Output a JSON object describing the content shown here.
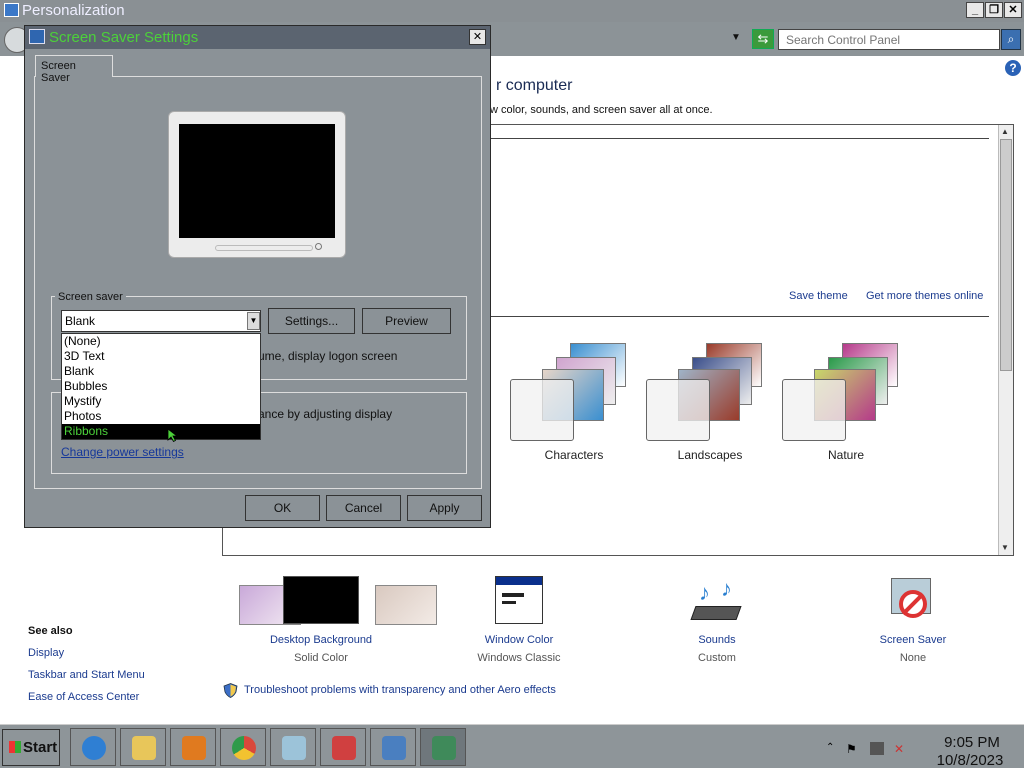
{
  "window": {
    "title": "Personalization",
    "minimize": "_",
    "restore": "❐",
    "close": "✕"
  },
  "address_bar": {
    "search_placeholder": "Search Control Panel",
    "dropdown_arrow": "▼",
    "refresh_glyph": "⇆",
    "search_glyph": "⌕"
  },
  "content": {
    "help_glyph": "?",
    "heading": "r computer",
    "subheading": "w color, sounds, and screen saver all at once.",
    "save_theme": "Save theme",
    "more_themes": "Get more themes online",
    "themes": [
      {
        "label": "Characters",
        "colors": [
          "#3a8fd0",
          "#d0a4cf",
          "#e7d5c8"
        ]
      },
      {
        "label": "Landscapes",
        "colors": [
          "#9a3b2a",
          "#3a4e8a",
          "#9fb3c7"
        ]
      },
      {
        "label": "Nature",
        "colors": [
          "#b53a8a",
          "#2a9a4a",
          "#c8d86a"
        ]
      }
    ],
    "settings": [
      {
        "title": "Desktop Background",
        "value": "Solid Color",
        "icon": "desktop-background-icon"
      },
      {
        "title": "Window Color",
        "value": "Windows Classic",
        "icon": "window-color-icon"
      },
      {
        "title": "Sounds",
        "value": "Custom",
        "icon": "sounds-icon"
      },
      {
        "title": "Screen Saver",
        "value": "None",
        "icon": "screen-saver-icon"
      }
    ],
    "see_also": {
      "title": "See also",
      "links": [
        "Display",
        "Taskbar and Start Menu",
        "Ease of Access Center"
      ]
    },
    "troubleshoot": "Troubleshoot problems with transparency and other Aero effects"
  },
  "dialog": {
    "title": "Screen Saver Settings",
    "close": "✕",
    "tab": "Screen Saver",
    "group_label": "Screen saver",
    "selected": "Blank",
    "select_arrow": "▼",
    "settings_btn": "Settings...",
    "preview_btn": "Preview",
    "logon_text": "ume, display logon screen",
    "power_text": "ance by adjusting display",
    "power_link": "Change power settings",
    "options": [
      "(None)",
      "3D Text",
      "Blank",
      "Bubbles",
      "Mystify",
      "Photos",
      "Ribbons"
    ],
    "highlighted_option": "Ribbons",
    "ok": "OK",
    "cancel": "Cancel",
    "apply": "Apply"
  },
  "taskbar": {
    "start": "Start",
    "apps": [
      {
        "name": "internet-explorer",
        "color": "#2f7fd3"
      },
      {
        "name": "file-explorer",
        "color": "#e8c65a"
      },
      {
        "name": "media-player",
        "color": "#e07a1f"
      },
      {
        "name": "chrome",
        "color": "#d9483b"
      },
      {
        "name": "notepad",
        "color": "#9cc3d9"
      },
      {
        "name": "font-viewer",
        "color": "#d04040"
      },
      {
        "name": "control-panel",
        "color": "#4a7fc0"
      },
      {
        "name": "display-settings",
        "color": "#3f8a5a"
      }
    ],
    "time": "9:05 PM",
    "date": "10/8/2023"
  }
}
